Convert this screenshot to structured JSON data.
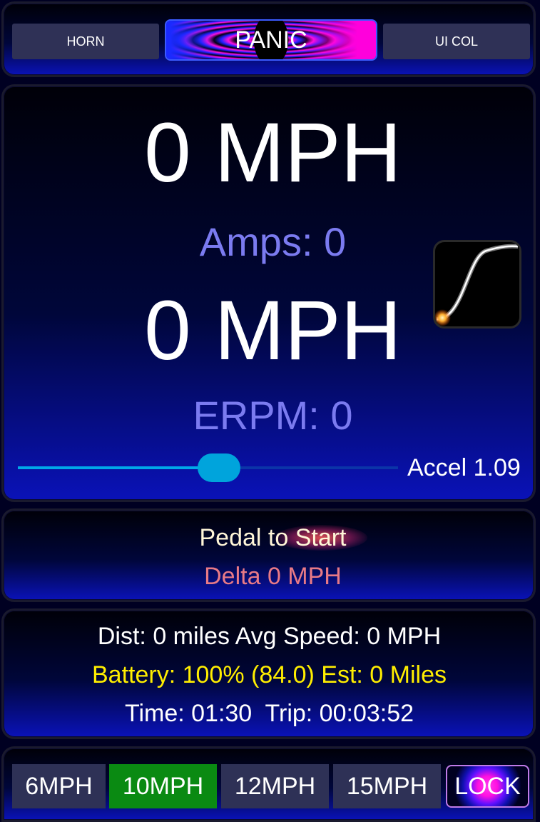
{
  "top_bar": {
    "horn_label": "HORN",
    "panic_label": "PANIC",
    "ui_col_label": "UI COL"
  },
  "speed": {
    "primary": "0 MPH",
    "amps": "Amps: 0",
    "secondary": "0 MPH",
    "erpm": "ERPM: 0",
    "accel_label": "Accel 1.09",
    "slider_level_fraction": 0.53
  },
  "pedal": {
    "status": "Pedal to Start",
    "delta": "Delta 0 MPH"
  },
  "stats": {
    "distance": "Dist: 0 miles Avg Speed: 0 MPH",
    "battery": "Battery: 100% (84.0) Est: 0 Miles",
    "time": "Time: 01:30  Trip: 00:03:52"
  },
  "modes": {
    "items": [
      "6MPH",
      "10MPH",
      "12MPH",
      "15MPH"
    ],
    "active": "10MPH",
    "lock_label": "LOCK"
  },
  "colors": {
    "accent_active": "#0a8a12",
    "subtext": "#7b7bf0",
    "battery": "#ffee00",
    "delta": "#e87a86",
    "slider": "#00a4dc"
  }
}
